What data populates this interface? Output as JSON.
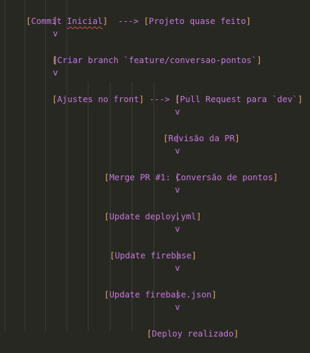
{
  "colors": {
    "background": "#272822",
    "bracket": "#e5a46a",
    "text": "#c678dd",
    "indent_guide": "#3b3c35",
    "spell_error": "#e05252"
  },
  "lines": {
    "l1": {
      "open": "[",
      "word1": "Commit ",
      "word2": "Inicial",
      "close": "]",
      "arrow": "  ---> ",
      "open2": "[",
      "text2": "Projeto quase feito",
      "close2": "]"
    },
    "l2": "|",
    "l3": "v",
    "l4": {
      "open": "[",
      "text": "Criar branch `feature/conversao-pontos`",
      "close": "]"
    },
    "l5": "|",
    "l6": "v",
    "l7": {
      "open": "[",
      "text": "Ajustes no front",
      "close": "]",
      "arrow": " ---> ",
      "open2": "[",
      "text2": "Pull Request para `dev`",
      "close2": "]"
    },
    "l8": "|",
    "l9": "v",
    "l10": {
      "open": "[",
      "text": "Revisão da PR",
      "close": "]"
    },
    "l11": "|",
    "l12": "v",
    "l13": {
      "open": "[",
      "text": "Merge PR #1: Conversão de pontos",
      "close": "]"
    },
    "l14": "|",
    "l15": "v",
    "l16": {
      "open": "[",
      "text": "Update deploy.yml",
      "close": "]"
    },
    "l17": "|",
    "l18": "v",
    "l19": {
      "open": "[",
      "text": "Update firebase",
      "close": "]"
    },
    "l20": "|",
    "l21": "v",
    "l22": {
      "open": "[",
      "text": "Update firebase.json",
      "close": "]"
    },
    "l23": "|",
    "l24": "v",
    "l25": {
      "open": "[",
      "text": "Deploy realizado",
      "close": "]"
    }
  }
}
